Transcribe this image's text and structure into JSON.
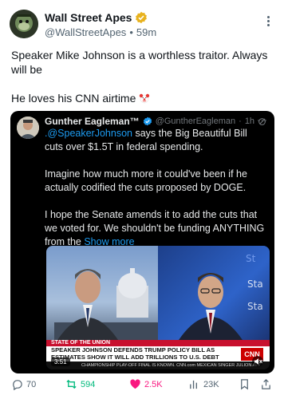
{
  "post": {
    "author_name": "Wall Street Apes",
    "handle": "@WallStreetApes",
    "separator": "•",
    "time": "59m",
    "text_line1": "Speaker Mike Johnson is a worthless traitor. Always will be",
    "text_line2": "He loves his CNN airtime"
  },
  "quote": {
    "author_name": "Gunther Eagleman™",
    "handle": "@GuntherEagleman",
    "separator": "·",
    "time": "1h",
    "more": "···",
    "p1_mention": ".@SpeakerJohnson",
    "p1_rest": " says the Big Beautiful Bill cuts over $1.5T in federal spending.",
    "p2": "Imagine how much more it could've been if he actually codified the cuts proposed by DOGE.",
    "p3": "I hope the Senate amends it to add the cuts that we voted for. We shouldn't be funding ANYTHING from the",
    "show_more": "Show more"
  },
  "video": {
    "banner_top": "STATE OF THE UNION",
    "headline": "SPEAKER JOHNSON DEFENDS TRUMP POLICY BILL AS ESTIMATES SHOW IT WILL ADD TRILLIONS TO U.S. DEBT",
    "ticker": "CHAMPIONSHIP PLAY-OFF FINAL IS KNOWN.   CNN.com   MEXICAN SINGER JULION ALV",
    "logo": "CNN",
    "timer": "3:51"
  },
  "actions": {
    "replies": "70",
    "reposts": "594",
    "likes": "2.5K",
    "views": "23K"
  },
  "colors": {
    "verified_gold": "#e8b21e",
    "verified_blue": "#1d9bf0",
    "repost_green": "#00ba7c",
    "like_pink": "#f91880",
    "cnn_red": "#cc0000"
  }
}
